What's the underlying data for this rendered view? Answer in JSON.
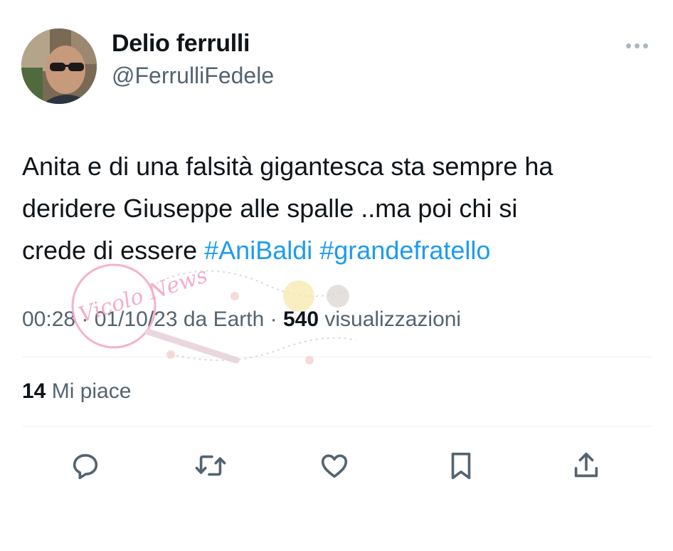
{
  "author": {
    "name": "Delio ferrulli",
    "handle": "@FerrulliFedele"
  },
  "tweet": {
    "lines": [
      "Anita e di una falsità gigantesca sta sempre ha",
      "deridere Giuseppe alle spalle ..ma poi chi si"
    ],
    "line3_prefix": "crede di essere ",
    "hashtags": [
      "#AniBaldi",
      "#grandefratello"
    ]
  },
  "meta": {
    "time": "00:28",
    "sep1": " · ",
    "date": "01/10/23",
    "source": " da Earth",
    "sep2": " · ",
    "views_count": "540",
    "views_label": " visualizzazioni"
  },
  "engagement": {
    "likes_count": "14",
    "likes_label": " Mi piace"
  },
  "watermark": {
    "text": "Vicolo News"
  },
  "colors": {
    "accent": "#1d9bf0",
    "secondary_text": "#536471",
    "action_icon": "#536471"
  },
  "icons": {
    "more": "more-horizontal-icon",
    "reply": "reply-icon",
    "retweet": "retweet-icon",
    "like": "heart-icon",
    "bookmark": "bookmark-icon",
    "share": "share-icon"
  }
}
